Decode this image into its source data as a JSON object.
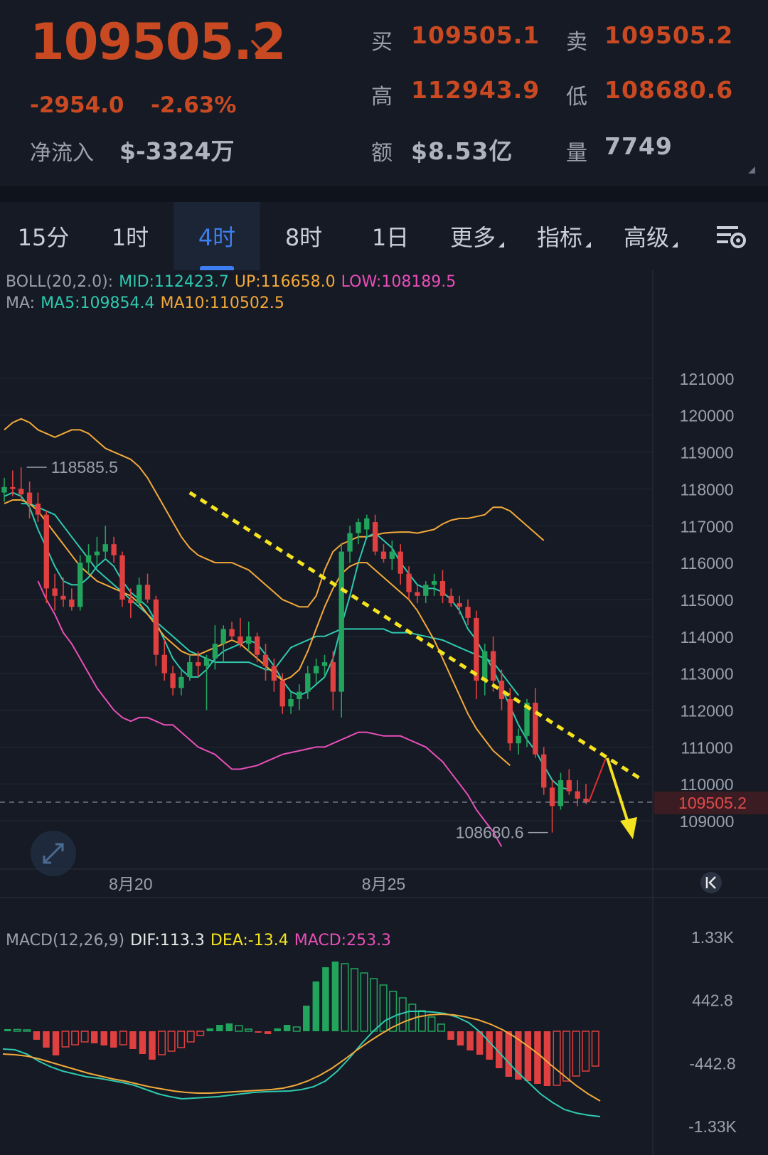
{
  "quote": {
    "last_price": "109505.2",
    "change": "-2954.0",
    "change_pct": "-2.63%",
    "netflow_label": "净流入",
    "netflow_value": "$-3324万",
    "bid_label": "买",
    "bid_value": "109505.1",
    "ask_label": "卖",
    "ask_value": "109505.2",
    "high_label": "高",
    "high_value": "112943.9",
    "low_label": "低",
    "low_value": "108680.6",
    "amount_label": "额",
    "amount_value": "$8.53亿",
    "volume_label": "量",
    "volume_value": "7749"
  },
  "tabs": [
    {
      "label": "15分",
      "active": false,
      "dropdown": false
    },
    {
      "label": "1时",
      "active": false,
      "dropdown": false
    },
    {
      "label": "4时",
      "active": true,
      "dropdown": false
    },
    {
      "label": "8时",
      "active": false,
      "dropdown": false
    },
    {
      "label": "1日",
      "active": false,
      "dropdown": false
    },
    {
      "label": "更多",
      "active": false,
      "dropdown": true
    },
    {
      "label": "指标",
      "active": false,
      "dropdown": true
    },
    {
      "label": "高级",
      "active": false,
      "dropdown": true
    }
  ],
  "settings_icon": "chart-settings-icon",
  "colors": {
    "up": "#22a45d",
    "down": "#e04040",
    "boll_mid": "#2fc9b0",
    "boll_up": "#f3a93a",
    "boll_low": "#e84fb8",
    "ma5": "#2fc9b0",
    "ma10": "#f3a93a",
    "dif": "#2fc9b0",
    "dea": "#f3a93a",
    "macd_text": "#e84fb8",
    "trend": "#f5e320",
    "price_tag_bg": "#3a1c22",
    "price_tag_fg": "#e04a4a"
  },
  "legend": {
    "boll_label": "BOLL(20,2.0):",
    "boll_mid": "MID:112423.7",
    "boll_up": "UP:116658.0",
    "boll_low": "LOW:108189.5",
    "ma_label": "MA:",
    "ma5": "MA5:109854.4",
    "ma10": "MA10:110502.5",
    "macd_label": "MACD(12,26,9)",
    "dif": "DIF:113.3",
    "dea": "DEA:-13.4",
    "macd": "MACD:253.3"
  },
  "annotations": {
    "period_high": "118585.5",
    "period_low": "108680.6",
    "current_price": "109505.2",
    "date_labels": [
      "8月20",
      "8月25"
    ],
    "date_label_index": [
      15,
      45
    ]
  },
  "chart_data": {
    "type": "candlestick",
    "timeframe": "4时",
    "ylim": [
      108500,
      122000
    ],
    "y_ticks": [
      121000,
      120000,
      119000,
      118000,
      117000,
      116000,
      115000,
      114000,
      113000,
      112000,
      111000,
      110000,
      109000
    ],
    "candles": [
      [
        117900,
        118300,
        117650,
        118050
      ],
      [
        118050,
        118500,
        117800,
        118000
      ],
      [
        118000,
        118585.5,
        117700,
        117850
      ],
      [
        117900,
        118200,
        117200,
        117600
      ],
      [
        117600,
        117900,
        117100,
        117300
      ],
      [
        117300,
        117400,
        114900,
        115300
      ],
      [
        115300,
        115700,
        114700,
        115100
      ],
      [
        115100,
        115600,
        114800,
        115000
      ],
      [
        115000,
        115300,
        114700,
        114800
      ],
      [
        114800,
        116200,
        114700,
        116000
      ],
      [
        116000,
        116500,
        115700,
        116200
      ],
      [
        116200,
        116700,
        115900,
        116300
      ],
      [
        116300,
        117000,
        116100,
        116500
      ],
      [
        116500,
        116700,
        116000,
        116200
      ],
      [
        116200,
        116300,
        114800,
        115000
      ],
      [
        115000,
        115300,
        114500,
        114900
      ],
      [
        114900,
        115600,
        114800,
        115400
      ],
      [
        115400,
        115700,
        114900,
        115000
      ],
      [
        115000,
        115100,
        113200,
        113500
      ],
      [
        113500,
        113900,
        112800,
        113000
      ],
      [
        113000,
        113200,
        112400,
        112600
      ],
      [
        112600,
        113100,
        112400,
        112900
      ],
      [
        112900,
        113500,
        112800,
        113300
      ],
      [
        113300,
        113600,
        112900,
        113200
      ],
      [
        113200,
        113500,
        112000,
        113400
      ],
      [
        113400,
        114300,
        113100,
        113800
      ],
      [
        113800,
        114300,
        113300,
        114200
      ],
      [
        114200,
        114400,
        113900,
        114000
      ],
      [
        114000,
        114500,
        113700,
        113800
      ],
      [
        113800,
        114400,
        113600,
        114000
      ],
      [
        114000,
        114100,
        113300,
        113500
      ],
      [
        113500,
        113800,
        112800,
        113200
      ],
      [
        113200,
        113400,
        112500,
        112800
      ],
      [
        112800,
        113000,
        111900,
        112100
      ],
      [
        112100,
        112500,
        111900,
        112300
      ],
      [
        112300,
        112700,
        112000,
        112500
      ],
      [
        112500,
        113200,
        112300,
        113000
      ],
      [
        113000,
        113400,
        112700,
        113200
      ],
      [
        113200,
        113500,
        112900,
        113300
      ],
      [
        113300,
        113600,
        112000,
        112500
      ],
      [
        112500,
        116500,
        111800,
        116300
      ],
      [
        116300,
        117000,
        116000,
        116800
      ],
      [
        116800,
        117200,
        116500,
        117100
      ],
      [
        116900,
        117300,
        116700,
        117200
      ],
      [
        117100,
        117300,
        116200,
        116300
      ],
      [
        116300,
        116500,
        116000,
        116100
      ],
      [
        116100,
        116600,
        115800,
        116300
      ],
      [
        116300,
        116500,
        115400,
        115700
      ],
      [
        115700,
        115900,
        115000,
        115200
      ],
      [
        115200,
        115400,
        114900,
        115100
      ],
      [
        115100,
        115500,
        114900,
        115400
      ],
      [
        115400,
        115700,
        115100,
        115500
      ],
      [
        115500,
        115800,
        114900,
        115100
      ],
      [
        115100,
        115300,
        114800,
        114900
      ],
      [
        114900,
        115100,
        114600,
        114800
      ],
      [
        114800,
        115000,
        114300,
        114500
      ],
      [
        114500,
        114700,
        112300,
        112800
      ],
      [
        112800,
        113800,
        112400,
        113600
      ],
      [
        113600,
        114000,
        112500,
        112800
      ],
      [
        112800,
        113100,
        112000,
        112300
      ],
      [
        112300,
        112600,
        110900,
        111100
      ],
      [
        111100,
        111500,
        110800,
        111300
      ],
      [
        111300,
        112300,
        111000,
        112200
      ],
      [
        112200,
        112600,
        110700,
        110800
      ],
      [
        110800,
        111000,
        109700,
        109900
      ],
      [
        109900,
        110100,
        108680.6,
        109400
      ],
      [
        109400,
        110300,
        109300,
        110100
      ],
      [
        110100,
        110400,
        109700,
        109800
      ],
      [
        109800,
        110100,
        109400,
        109600
      ],
      [
        109600,
        110000,
        109450,
        109505.2
      ]
    ],
    "boll_up": [
      119600,
      119800,
      119900,
      119800,
      119600,
      119500,
      119400,
      119500,
      119600,
      119600,
      119500,
      119300,
      119100,
      119000,
      118900,
      118800,
      118600,
      118300,
      117900,
      117500,
      117100,
      116700,
      116400,
      116200,
      116100,
      116000,
      116000,
      116000,
      115900,
      115800,
      115600,
      115400,
      115200,
      115000,
      114900,
      114800,
      114800,
      115100,
      115800,
      116300,
      116500,
      116600,
      116700,
      116700,
      116750,
      116800,
      116820,
      116830,
      116830,
      116800,
      116850,
      116900,
      117050,
      117150,
      117200,
      117200,
      117250,
      117300,
      117500,
      117500,
      117400,
      117200,
      117000,
      116800,
      116600
    ],
    "boll_mid": [
      117600,
      117600,
      117500,
      117400,
      117300,
      117000,
      116700,
      116400,
      116100,
      115800,
      115600,
      115400,
      115200,
      115000,
      114800,
      114600,
      114400,
      114200,
      114000,
      113800,
      113600,
      113500,
      113400,
      113300,
      113300,
      113300,
      113300,
      113300,
      113200,
      113100,
      113100,
      113400,
      113700,
      113800,
      113900,
      114000,
      114000,
      114100,
      114200,
      114200,
      114200,
      114200,
      114200,
      114200,
      114100,
      114100,
      114100,
      114050,
      114000,
      113950,
      113900,
      113800,
      113700,
      113600,
      113500,
      113400,
      113300,
      113000,
      112700,
      112400
    ],
    "boll_low": [
      115500,
      115000,
      114600,
      114100,
      113800,
      113400,
      113000,
      112600,
      112300,
      112000,
      111800,
      111700,
      111800,
      111800,
      111700,
      111600,
      111600,
      111400,
      111200,
      111000,
      110900,
      110800,
      110600,
      110400,
      110400,
      110450,
      110500,
      110600,
      110700,
      110800,
      110850,
      110900,
      110950,
      111000,
      111000,
      111100,
      111200,
      111300,
      111400,
      111400,
      111350,
      111300,
      111300,
      111300,
      111200,
      111100,
      111000,
      110800,
      110600,
      110300,
      110000,
      109700,
      109300,
      109000,
      108700,
      108300
    ],
    "boll_start_index": [
      0,
      2,
      4
    ],
    "ma5": [
      117800,
      117900,
      117800,
      117500,
      116900,
      116400,
      115900,
      115500,
      115400,
      115400,
      115600,
      115900,
      116100,
      115900,
      115500,
      115200,
      115000,
      114800,
      114400,
      113900,
      113400,
      113100,
      112900,
      112900,
      113100,
      113400,
      113600,
      113700,
      113800,
      113900,
      113800,
      113500,
      113200,
      112800,
      112500,
      112400,
      112500,
      112700,
      112900,
      113400,
      114300,
      115100,
      116000,
      116700,
      116800,
      116600,
      116400,
      116000,
      115700,
      115400,
      115300,
      115300,
      115200,
      115000,
      114700,
      114200,
      113900,
      113500,
      113100,
      112600,
      112100,
      111600,
      111200,
      110900,
      110500,
      110100,
      109900,
      109850
    ],
    "ma10": [
      117600,
      117700,
      117700,
      117600,
      117400,
      117100,
      116800,
      116500,
      116200,
      115900,
      115700,
      115500,
      115400,
      115300,
      115200,
      115100,
      114900,
      114600,
      114300,
      114000,
      113800,
      113600,
      113500,
      113500,
      113600,
      113700,
      113800,
      113900,
      113800,
      113600,
      113400,
      113200,
      113000,
      112800,
      112900,
      113100,
      113600,
      114200,
      114800,
      115300,
      115700,
      115900,
      116000,
      116000,
      115800,
      115600,
      115400,
      115200,
      115000,
      114700,
      114300,
      113900,
      113400,
      112900,
      112400,
      111900,
      111500,
      111200,
      110900,
      110700,
      110500
    ],
    "macd_hist": [
      30,
      25,
      20,
      -120,
      -230,
      -340,
      -220,
      -190,
      -150,
      -170,
      -200,
      -230,
      -190,
      -250,
      -320,
      -400,
      -330,
      -280,
      -230,
      -150,
      -60,
      40,
      90,
      110,
      80,
      30,
      -20,
      -40,
      40,
      90,
      60,
      360,
      700,
      900,
      980,
      950,
      880,
      820,
      740,
      650,
      560,
      470,
      380,
      290,
      200,
      100,
      -120,
      -200,
      -270,
      -330,
      -400,
      -520,
      -640,
      -680,
      -700,
      -740,
      -770,
      -760,
      -700,
      -630,
      -560,
      -490
    ],
    "macd_dif": [
      -250,
      -260,
      -320,
      -420,
      -500,
      -560,
      -600,
      -640,
      -660,
      -690,
      -720,
      -760,
      -820,
      -880,
      -920,
      -950,
      -940,
      -930,
      -920,
      -900,
      -880,
      -860,
      -850,
      -845,
      -840,
      -820,
      -780,
      -700,
      -560,
      -380,
      -180,
      0,
      150,
      230,
      280,
      280,
      270,
      250,
      200,
      120,
      -20,
      -200,
      -380,
      -560,
      -720,
      -880,
      -1000,
      -1100,
      -1150,
      -1180,
      -1200
    ],
    "macd_dea": [
      -320,
      -330,
      -350,
      -390,
      -440,
      -490,
      -540,
      -590,
      -630,
      -670,
      -700,
      -740,
      -780,
      -810,
      -840,
      -860,
      -870,
      -870,
      -860,
      -850,
      -840,
      -830,
      -820,
      -800,
      -760,
      -700,
      -620,
      -520,
      -400,
      -270,
      -150,
      -40,
      60,
      140,
      200,
      230,
      240,
      230,
      200,
      160,
      100,
      20,
      -80,
      -200,
      -330,
      -480,
      -620,
      -760,
      -880,
      -980
    ],
    "macd_ylim": [
      -1400,
      1400
    ],
    "macd_ticks": [
      "1.33K",
      "442.8",
      "-442.8",
      "-1.33K"
    ]
  }
}
